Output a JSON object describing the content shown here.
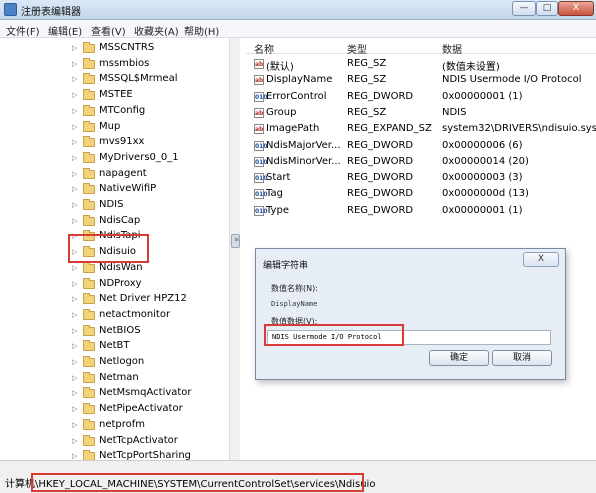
{
  "window": {
    "title": "注册表编辑器",
    "btn_min": "—",
    "btn_max": "□",
    "btn_close": "X"
  },
  "menu": [
    "文件(F)",
    "编辑(E)",
    "查看(V)",
    "收藏夹(A)",
    "帮助(H)"
  ],
  "tree": {
    "items": [
      "MSSCNTRS",
      "mssmbios",
      "MSSQL$Mrmeal",
      "MSTEE",
      "MTConfig",
      "Mup",
      "mvs91xx",
      "MyDrivers0_0_1",
      "napagent",
      "NativeWifiP",
      "NDIS",
      "NdisCap",
      "NdisTapi",
      "Ndisuio",
      "NdisWan",
      "NDProxy",
      "Net Driver HPZ12",
      "netactmonitor",
      "NetBIOS",
      "NetBT",
      "Netlogon",
      "Netman",
      "NetMsmqActivator",
      "NetPipeActivator",
      "netprofm",
      "NetTcpActivator",
      "NetTcpPortSharing"
    ],
    "selected": "Ndisuio",
    "expand_glyph": "▷"
  },
  "list": {
    "headers": {
      "name": "名称",
      "type": "类型",
      "data": "数据"
    },
    "rows": [
      {
        "name": "(默认)",
        "type": "REG_SZ",
        "data": "(数值未设置)",
        "icon": "ab"
      },
      {
        "name": "DisplayName",
        "type": "REG_SZ",
        "data": "NDIS Usermode I/O Protocol",
        "icon": "ab"
      },
      {
        "name": "ErrorControl",
        "type": "REG_DWORD",
        "data": "0x00000001 (1)",
        "icon": "010"
      },
      {
        "name": "Group",
        "type": "REG_SZ",
        "data": "NDIS",
        "icon": "ab"
      },
      {
        "name": "ImagePath",
        "type": "REG_EXPAND_SZ",
        "data": "system32\\DRIVERS\\ndisuio.sys",
        "icon": "ab"
      },
      {
        "name": "NdisMajorVer...",
        "type": "REG_DWORD",
        "data": "0x00000006 (6)",
        "icon": "010"
      },
      {
        "name": "NdisMinorVer...",
        "type": "REG_DWORD",
        "data": "0x00000014 (20)",
        "icon": "010"
      },
      {
        "name": "Start",
        "type": "REG_DWORD",
        "data": "0x00000003 (3)",
        "icon": "010"
      },
      {
        "name": "Tag",
        "type": "REG_DWORD",
        "data": "0x0000000d (13)",
        "icon": "010"
      },
      {
        "name": "Type",
        "type": "REG_DWORD",
        "data": "0x00000001 (1)",
        "icon": "010"
      }
    ]
  },
  "dialog": {
    "title": "编辑字符串",
    "close": "X",
    "name_label": "数值名称(N):",
    "name_value": "DisplayName",
    "data_label": "数值数据(V):",
    "data_value": "NDIS Usermode I/O Protocol",
    "ok": "确定",
    "cancel": "取消"
  },
  "status": {
    "path": "计算机\\HKEY_LOCAL_MACHINE\\SYSTEM\\CurrentControlSet\\services\\Ndisuio"
  },
  "colors": {
    "highlight_box": "#d83a36"
  }
}
